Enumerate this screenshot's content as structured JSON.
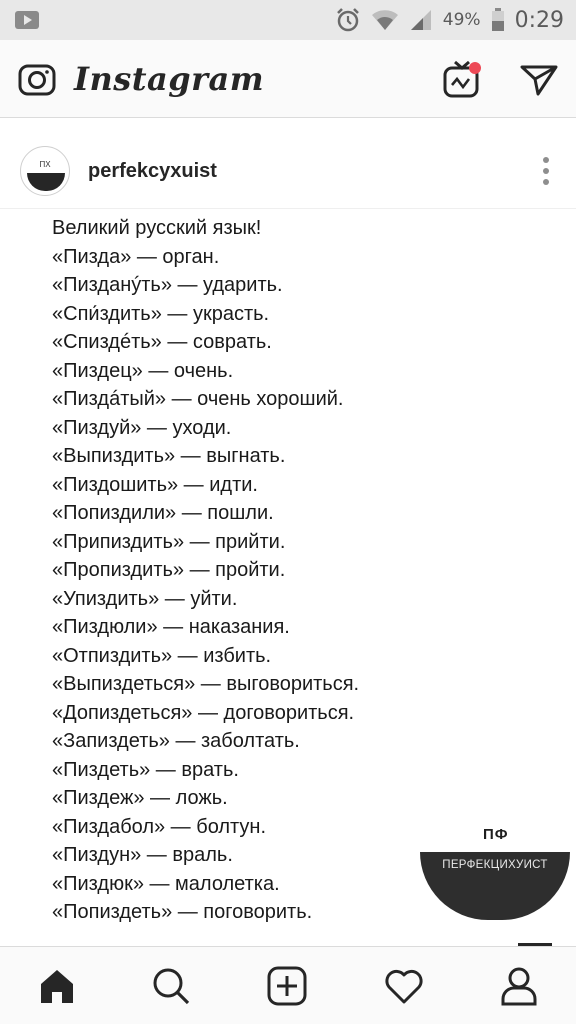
{
  "status_bar": {
    "battery_percent": "49%",
    "time": "0:29",
    "icons": [
      "notification-icon",
      "alarm-icon",
      "wifi-icon",
      "signal-icon",
      "battery-icon"
    ]
  },
  "app_header": {
    "brand": "Instagram",
    "icons": [
      "camera-icon",
      "igtv-icon",
      "direct-message-icon"
    ],
    "accent_color": "#ed4956"
  },
  "post": {
    "username": "perfekcyxuist",
    "avatar_text": "ПХ",
    "lines": [
      "Великий русский язык!",
      "«Пизда» — орган.",
      "«Пизданýть» — ударить.",
      "«Спи́здить» — украсть.",
      "«Спиздéть» — соврать.",
      "«Пиздец» — очень.",
      "«Пиздáтый» — очень хороший.",
      "«Пиздуй» — уходи.",
      "«Выпиздить» — выгнать.",
      "«Пиздошить» — идти.",
      "«Попиздили» — пошли.",
      "«Припиздить» — прийти.",
      "«Пропиздить» — пройти.",
      "«Упиздить» — уйти.",
      "«Пиздюли» — наказания.",
      "«Отпиздить» — избить.",
      "«Выпиздеться» — выговориться.",
      "«Допиздеться» — договориться.",
      "«Запиздеть» — заболтать.",
      "«Пиздеть» — врать.",
      "«Пиздеж» — ложь.",
      "«Пиздабол» — болтун.",
      "«Пиздун» — враль.",
      "«Пиздюк» — малолетка.",
      "«Попиздеть» — поговорить."
    ],
    "watermark_short": "ПФ",
    "watermark_long": "ПЕРФЕКЦИХУИСТ"
  },
  "tab_bar": {
    "items": [
      "home-icon",
      "search-icon",
      "new-post-icon",
      "activity-icon",
      "profile-icon"
    ]
  }
}
